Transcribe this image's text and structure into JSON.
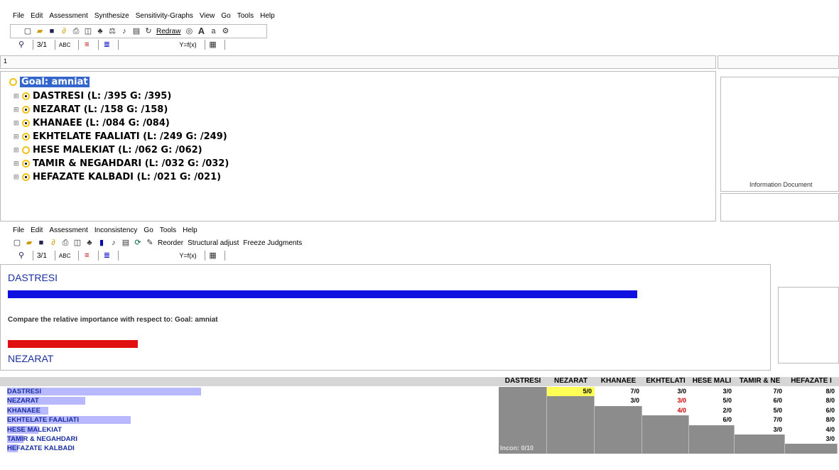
{
  "top_menu": [
    "File",
    "Edit",
    "Assessment",
    "Synthesize",
    "Sensitivity-Graphs",
    "View",
    "Go",
    "Tools",
    "Help"
  ],
  "top_toolbar": {
    "redraw_label": "Redraw"
  },
  "format_toolbar": {
    "num_label": "3/1",
    "abc_label": "ABC",
    "fx_label": "Y=f(x)"
  },
  "ruler_marker": "1",
  "tree": {
    "goal": "Goal: amniat",
    "items": [
      {
        "label": "DASTRESI (L: /395 G: /395)"
      },
      {
        "label": "NEZARAT (L: /158 G: /158)"
      },
      {
        "label": "KHANAEE (L: /084 G: /084)"
      },
      {
        "label": "EKHTELATE FAALIATI (L: /249 G: /249)"
      },
      {
        "label": "HESE MALEKIAT (L: /062 G: /062)"
      },
      {
        "label": "TAMIR & NEGAHDARI (L: /032 G: /032)"
      },
      {
        "label": "HEFAZATE KALBADI (L: /021 G: /021)"
      }
    ]
  },
  "info_panel": {
    "label": "Information Document"
  },
  "bottom_menu": [
    "File",
    "Edit",
    "Assessment",
    "Inconsistency",
    "Go",
    "Tools",
    "Help"
  ],
  "bottom_toolbar": {
    "reorder_label": "Reorder",
    "structural_label": "Structural adjust",
    "freeze_label": "Freeze Judgments"
  },
  "comparison": {
    "left_element": "DASTRESI",
    "right_element": "NEZARAT",
    "prompt": "Compare the relative importance  with respect to: Goal: amniat",
    "left_bar_fraction": 0.75,
    "right_bar_fraction": 0.155,
    "left_color": "#1010e0",
    "right_color": "#e01010"
  },
  "matrix": {
    "headers": [
      "DASTRESI",
      "NEZARAT",
      "KHANAEE",
      "EKHTELATI",
      "HESE MALI",
      "TAMIR & NE",
      "HEFAZATE I"
    ],
    "rows": [
      {
        "label": "DASTRESI",
        "bar": 0.94,
        "cells": [
          "",
          "5/0",
          "7/0",
          "3/0",
          "3/0",
          "7/0",
          "8/0"
        ]
      },
      {
        "label": "NEZARAT",
        "bar": 0.38,
        "cells": [
          "",
          "",
          "3/0",
          "3/0",
          "5/0",
          "6/0",
          "8/0"
        ]
      },
      {
        "label": "KHANAEE",
        "bar": 0.2,
        "cells": [
          "",
          "",
          "",
          "4/0",
          "2/0",
          "5/0",
          "6/0"
        ]
      },
      {
        "label": "EKHTELATE FAALIATI",
        "bar": 0.6,
        "cells": [
          "",
          "",
          "",
          "",
          "6/0",
          "7/0",
          "8/0"
        ]
      },
      {
        "label": "HESE MALEKIAT",
        "bar": 0.15,
        "cells": [
          "",
          "",
          "",
          "",
          "",
          "3/0",
          "4/0"
        ]
      },
      {
        "label": "TAMIR & NEGAHDARI",
        "bar": 0.08,
        "cells": [
          "",
          "",
          "",
          "",
          "",
          "",
          "3/0"
        ]
      },
      {
        "label": "HEFAZATE KALBADI",
        "bar": 0.05,
        "cells": [
          "",
          "",
          "",
          "",
          "",
          "",
          ""
        ]
      }
    ],
    "inconsistency": "Incon: 0/10",
    "highlight_color": "#ffff55",
    "red_values_color": "#cc0000"
  }
}
